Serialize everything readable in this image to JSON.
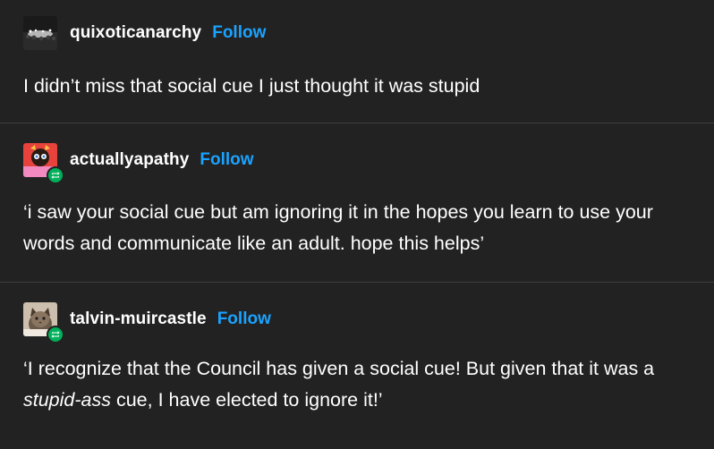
{
  "posts": [
    {
      "username": "quixoticanarchy",
      "follow_label": "Follow",
      "avatar_icon": "concert-crowd-avatar",
      "reblog": false,
      "text": "I didn’t miss that social cue I just thought it was stupid"
    },
    {
      "username": "actuallyapathy",
      "follow_label": "Follow",
      "avatar_icon": "cartoon-character-avatar",
      "reblog": true,
      "text": "‘i saw your social cue but am ignoring it in the hopes you learn to use your words and communicate like an adult.  hope this helps’"
    },
    {
      "username": "talvin-muircastle",
      "follow_label": "Follow",
      "avatar_icon": "cat-photo-avatar",
      "reblog": true,
      "text_before": "‘I recognize that the Council has given a social cue! But given that it was a ",
      "text_emphasis": "stupid-ass",
      "text_after": " cue, I have elected to ignore it!’"
    }
  ],
  "colors": {
    "background": "#222222",
    "divider": "#3d3d3d",
    "follow": "#1aa3ff",
    "reblog_badge": "#00b05a",
    "text": "#ffffff"
  }
}
